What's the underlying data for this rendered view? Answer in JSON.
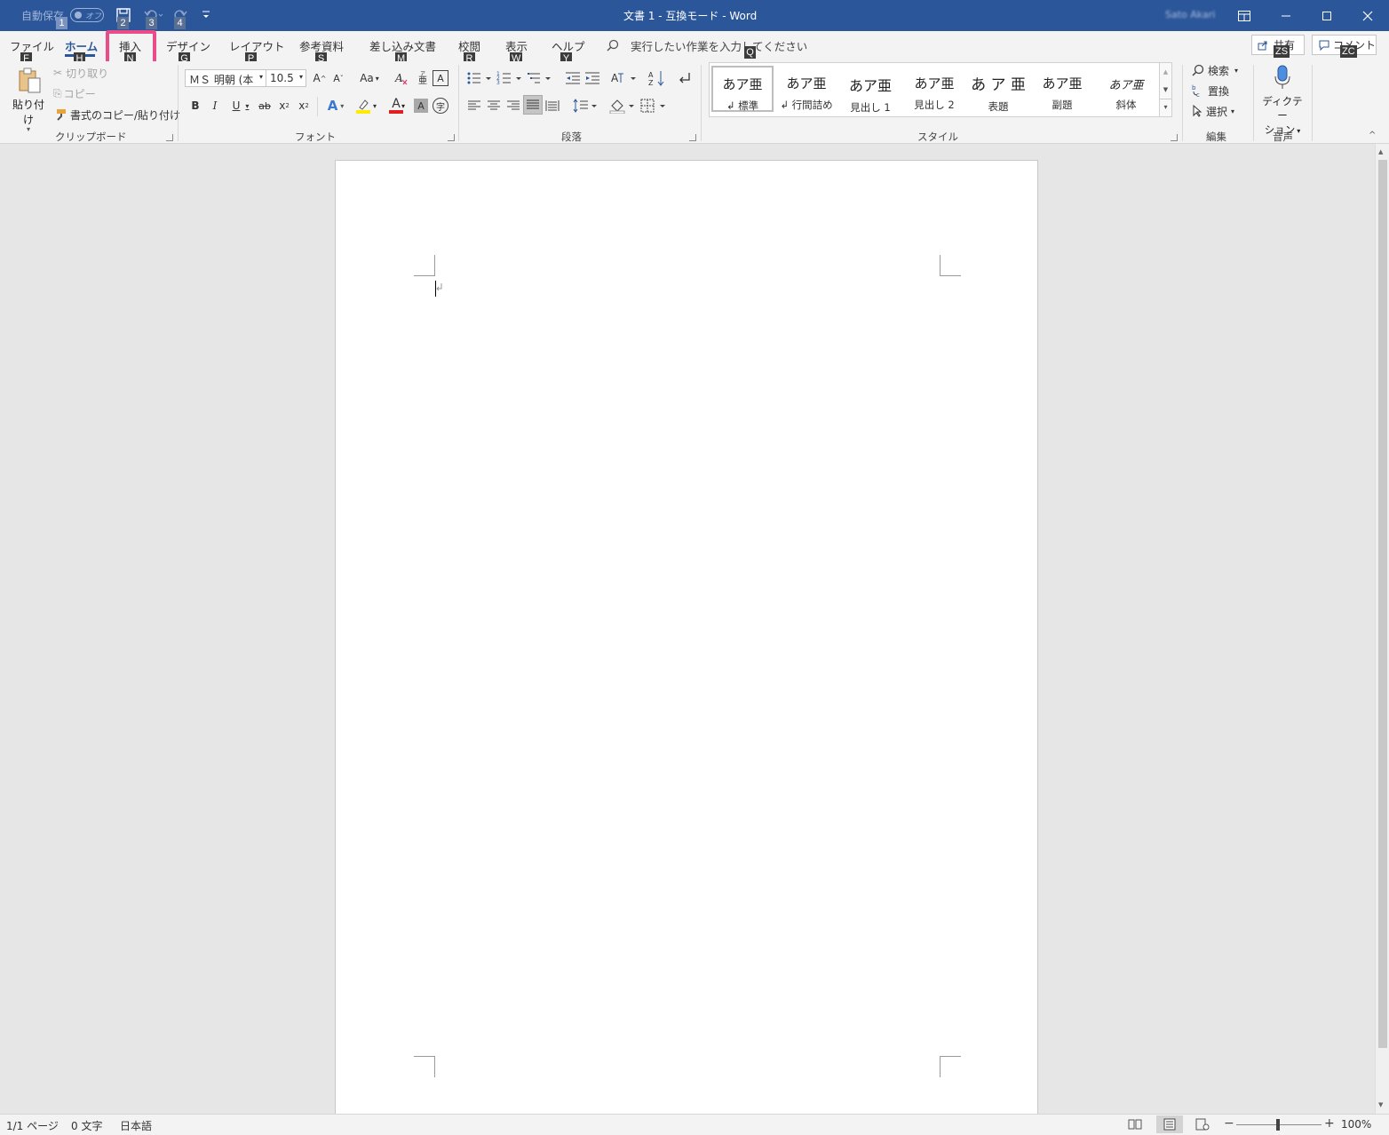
{
  "titlebar": {
    "title": "文書 1  -  互換モード  -  Word",
    "autosave_label": "自動保存",
    "autosave_state": "オフ",
    "user_name": "Sato Akari"
  },
  "keytips": {
    "qat": [
      "1",
      "2",
      "3",
      "4"
    ],
    "tabs": [
      "F",
      "H",
      "N",
      "G",
      "P",
      "S",
      "M",
      "R",
      "W",
      "Y"
    ],
    "search": "Q",
    "share": "ZS",
    "comment": "ZC"
  },
  "tabs": [
    {
      "label": "ファイル"
    },
    {
      "label": "ホーム",
      "selected": true
    },
    {
      "label": "挿入",
      "highlighted": true
    },
    {
      "label": "デザイン"
    },
    {
      "label": "レイアウト"
    },
    {
      "label": "参考資料"
    },
    {
      "label": "差し込み文書"
    },
    {
      "label": "校閲"
    },
    {
      "label": "表示"
    },
    {
      "label": "ヘルプ"
    }
  ],
  "search_placeholder": "実行したい作業を入力してください",
  "share_label": "共有",
  "comment_label": "コメント",
  "clipboard": {
    "paste": "貼り付け",
    "cut": "切り取り",
    "copy": "コピー",
    "format_painter": "書式のコピー/貼り付け",
    "group": "クリップボード"
  },
  "font": {
    "name": "ＭＳ 明朝 (本",
    "size": "10.5",
    "change_case": "Aa",
    "group": "フォント",
    "bold": "B",
    "italic": "I",
    "underline": "U",
    "strike": "ab",
    "subscript": "x",
    "superscript": "x",
    "grow": "A",
    "shrink": "A",
    "effects": "A",
    "color": "A",
    "shade": "A",
    "border": "A",
    "phonetic": "亜",
    "circle": "字"
  },
  "paragraph": {
    "group": "段落"
  },
  "styles": {
    "group": "スタイル",
    "items": [
      {
        "preview": "あア亜",
        "label": "↲ 標準",
        "selected": true
      },
      {
        "preview": "あア亜",
        "label": "↲ 行間詰め"
      },
      {
        "preview": "あア亜",
        "label": "見出し 1"
      },
      {
        "preview": "あア亜",
        "label": "見出し 2"
      },
      {
        "preview": "あ ア 亜",
        "label": "表題"
      },
      {
        "preview": "あア亜",
        "label": "副題"
      },
      {
        "preview": "あア亜",
        "label": "斜体"
      }
    ]
  },
  "editing": {
    "find": "検索",
    "replace": "置換",
    "select": "選択",
    "group": "編集"
  },
  "voice": {
    "dictate_1": "ディクテー",
    "dictate_2": "ション",
    "group": "音声"
  },
  "status": {
    "page": "1/1 ページ",
    "words": "0 文字",
    "language": "日本語",
    "zoom": "100%"
  },
  "colors": {
    "titlebar": "#2b579a",
    "highlight_box": "#ea4c89",
    "ribbon_bg": "#f3f3f3",
    "canvas_bg": "#e6e6e6"
  }
}
